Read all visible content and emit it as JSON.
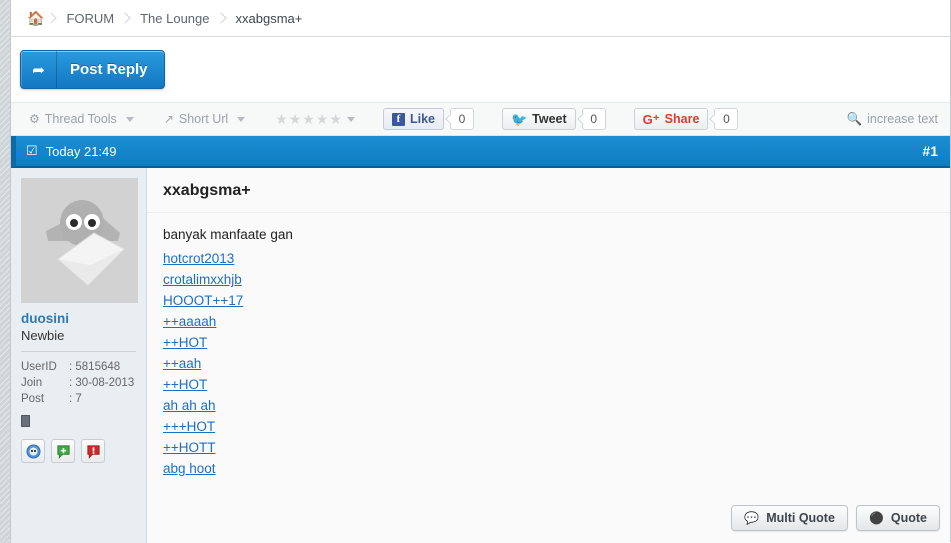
{
  "breadcrumb": {
    "home_icon": "home-icon",
    "items": [
      {
        "label": "FORUM"
      },
      {
        "label": "The Lounge"
      },
      {
        "label": "xxabgsma+"
      }
    ]
  },
  "reply": {
    "label": "Post Reply",
    "icon": "reply-arrow-icon"
  },
  "tools": {
    "thread_tools": "Thread Tools",
    "short_url": "Short Url",
    "stars": "★★★★★",
    "increase_text": "increase text",
    "social": [
      {
        "name": "facebook",
        "label": "Like",
        "count": "0",
        "glyph": "f"
      },
      {
        "name": "twitter",
        "label": "Tweet",
        "count": "0",
        "glyph": "🐦"
      },
      {
        "name": "googleplus",
        "label": "Share",
        "count": "0",
        "glyph": "G⁺"
      }
    ]
  },
  "post": {
    "timestamp": "Today 21:49",
    "number": "#1",
    "title": "xxabgsma+",
    "intro": "banyak manfaate gan",
    "links": [
      "hotcrot2013",
      "crotalimxxhjb",
      "HOOOT++17",
      "++aaaah",
      "++HOT",
      "++aah",
      "++HOT",
      "ah ah ah",
      "+++HOT",
      "++HOTT",
      "abg hoot"
    ],
    "multi_quote": "Multi Quote",
    "quote": "Quote"
  },
  "user": {
    "name": "duosini",
    "rank": "Newbie",
    "stats": [
      {
        "key": "UserID",
        "sep": ": ",
        "value": "5815648"
      },
      {
        "key": "Join",
        "sep": ": ",
        "value": "30-08-2013"
      },
      {
        "key": "Post",
        "sep": ": ",
        "value": "7"
      }
    ]
  },
  "colors": {
    "accent": "#0f7cc0",
    "link": "#1e6fc4",
    "sidebar": "#e9eef3"
  }
}
